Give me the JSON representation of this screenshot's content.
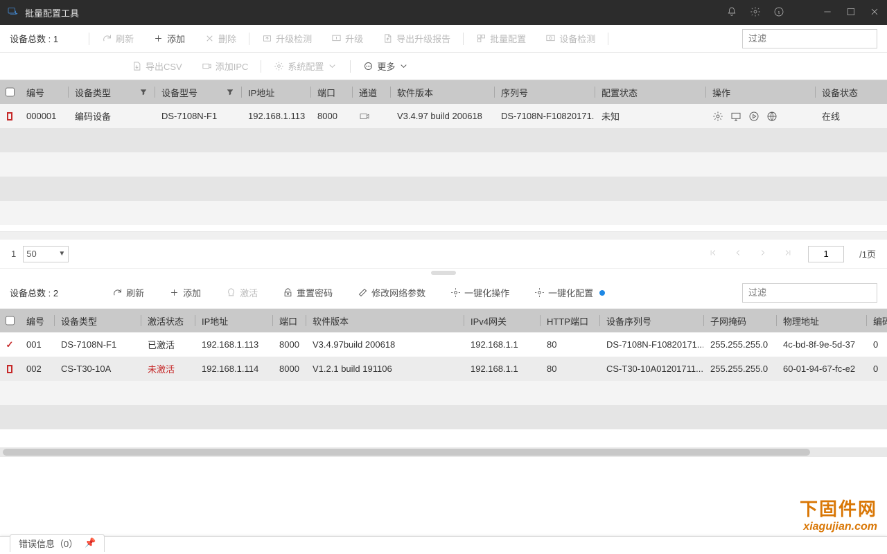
{
  "title": "批量配置工具",
  "upper": {
    "device_total_label": "设备总数 : 1",
    "toolbar": {
      "refresh": "刷新",
      "add": "添加",
      "delete": "删除",
      "upgrade_check": "升级检测",
      "upgrade": "升级",
      "export_report": "导出升级报告",
      "batch_config": "批量配置",
      "device_check": "设备检测",
      "export_csv": "导出CSV",
      "add_ipc": "添加IPC",
      "sys_config": "系统配置",
      "more": "更多"
    },
    "filter_placeholder": "过滤",
    "columns": [
      "编号",
      "设备类型",
      "设备型号",
      "IP地址",
      "端口",
      "通道",
      "软件版本",
      "序列号",
      "配置状态",
      "操作",
      "设备状态"
    ],
    "row": {
      "id": "000001",
      "type": "编码设备",
      "model": "DS-7108N-F1",
      "ip": "192.168.1.113",
      "port": "8000",
      "channel_icon": "link",
      "sw": "V3.4.97 build 200618",
      "serial": "DS-7108N-F10820171...",
      "cfg_status": "未知",
      "dev_status": "在线"
    },
    "pager": {
      "page_label": "1",
      "page_size": "50",
      "page_input": "1",
      "total_pages": "/1页"
    }
  },
  "lower": {
    "device_total_label": "设备总数 : 2",
    "toolbar": {
      "refresh": "刷新",
      "add": "添加",
      "activate": "激活",
      "reset_pwd": "重置密码",
      "mod_net": "修改网络参数",
      "onekey_op": "一键化操作",
      "onekey_cfg": "一键化配置"
    },
    "filter_placeholder": "过滤",
    "columns": [
      "编号",
      "设备类型",
      "激活状态",
      "IP地址",
      "端口",
      "软件版本",
      "IPv4网关",
      "HTTP端口",
      "设备序列号",
      "子网掩码",
      "物理地址",
      "编码"
    ],
    "rows": [
      {
        "checked": true,
        "id": "001",
        "type": "DS-7108N-F1",
        "act": "已激活",
        "act_red": false,
        "ip": "192.168.1.113",
        "port": "8000",
        "sw": "V3.4.97build 200618",
        "gw": "192.168.1.1",
        "http": "80",
        "serial": "DS-7108N-F10820171...",
        "mask": "255.255.255.0",
        "mac": "4c-bd-8f-9e-5d-37",
        "enc": "0"
      },
      {
        "checked": false,
        "id": "002",
        "type": "CS-T30-10A",
        "act": "未激活",
        "act_red": true,
        "ip": "192.168.1.114",
        "port": "8000",
        "sw": "V1.2.1 build 191106",
        "gw": "192.168.1.1",
        "http": "80",
        "serial": "CS-T30-10A01201711...",
        "mask": "255.255.255.0",
        "mac": "60-01-94-67-fc-e2",
        "enc": "0"
      }
    ]
  },
  "statusbar": {
    "label": "错误信息（0）"
  },
  "watermark": {
    "cn": "下固件网",
    "url": "xiagujian.com"
  }
}
